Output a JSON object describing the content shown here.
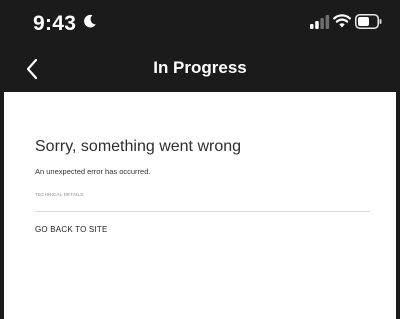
{
  "status_bar": {
    "time": "9:43",
    "icons": [
      "moon-icon",
      "signal-icon",
      "wifi-icon",
      "battery-icon"
    ]
  },
  "nav": {
    "title": "In Progress",
    "back_icon": "chevron-left-icon"
  },
  "error": {
    "title": "Sorry, something went wrong",
    "message": "An unexpected error has occurred.",
    "technical_details": "TECHNICAL DETAILS",
    "back_link": "GO BACK TO SITE"
  },
  "colors": {
    "chrome_background": "#1b1b1b",
    "content_background": "#ffffff",
    "text_primary": "#2e2e2e",
    "text_muted": "#888888",
    "divider": "#d8d8d8"
  }
}
